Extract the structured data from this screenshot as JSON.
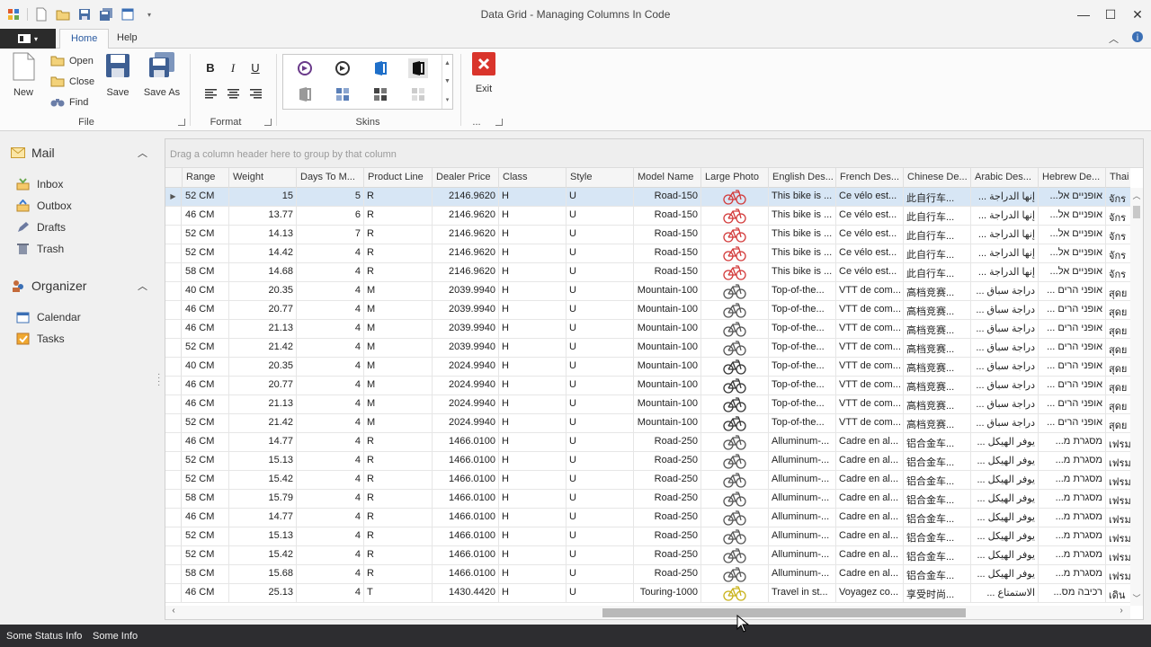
{
  "window": {
    "title": "Data Grid - Managing Columns In Code"
  },
  "ribbon": {
    "tabs": [
      "Home",
      "Help"
    ],
    "file_group": {
      "label": "File",
      "new": "New",
      "open": "Open",
      "close": "Close",
      "find": "Find",
      "save": "Save",
      "save_as": "Save As"
    },
    "format_group": {
      "label": "Format",
      "bold": "B",
      "italic": "I",
      "underline": "U"
    },
    "skins_group": {
      "label": "Skins"
    },
    "exit_group": {
      "label": "...",
      "exit": "Exit"
    }
  },
  "navigation": {
    "mail": {
      "title": "Mail",
      "items": [
        "Inbox",
        "Outbox",
        "Drafts",
        "Trash"
      ]
    },
    "organizer": {
      "title": "Organizer",
      "items": [
        "Calendar",
        "Tasks"
      ]
    }
  },
  "grid": {
    "group_panel_text": "Drag a column header here to group by that column",
    "columns": [
      "Range",
      "Weight",
      "Days To M...",
      "Product Line",
      "Dealer Price",
      "Class",
      "Style",
      "Model Name",
      "Large Photo",
      "English Des...",
      "French Des...",
      "Chinese De...",
      "Arabic Des...",
      "Hebrew De...",
      "Thai De"
    ],
    "rows": [
      [
        "52 CM",
        "15",
        "5",
        "R",
        "2146.9620",
        "H",
        "U",
        "Road-150",
        "",
        "This bike is ...",
        "Ce vélo est...",
        "此自行车...",
        "إنها الدراجة ...",
        "אופניים אל...",
        "จักร"
      ],
      [
        "46 CM",
        "13.77",
        "6",
        "R",
        "2146.9620",
        "H",
        "U",
        "Road-150",
        "",
        "This bike is ...",
        "Ce vélo est...",
        "此自行车...",
        "إنها الدراجة ...",
        "אופניים אל...",
        "จักร"
      ],
      [
        "52 CM",
        "14.13",
        "7",
        "R",
        "2146.9620",
        "H",
        "U",
        "Road-150",
        "",
        "This bike is ...",
        "Ce vélo est...",
        "此自行车...",
        "إنها الدراجة ...",
        "אופניים אל...",
        "จักร"
      ],
      [
        "52 CM",
        "14.42",
        "4",
        "R",
        "2146.9620",
        "H",
        "U",
        "Road-150",
        "",
        "This bike is ...",
        "Ce vélo est...",
        "此自行车...",
        "إنها الدراجة ...",
        "אופניים אל...",
        "จักร"
      ],
      [
        "58 CM",
        "14.68",
        "4",
        "R",
        "2146.9620",
        "H",
        "U",
        "Road-150",
        "",
        "This bike is ...",
        "Ce vélo est...",
        "此自行车...",
        "إنها الدراجة ...",
        "אופניים אל...",
        "จักร"
      ],
      [
        "40 CM",
        "20.35",
        "4",
        "M",
        "2039.9940",
        "H",
        "U",
        "Mountain-100",
        "",
        "Top-of-the...",
        "VTT de com...",
        "高档竞赛...",
        "دراجة سباق ...",
        "אופני הרים ...",
        "สุดย"
      ],
      [
        "46 CM",
        "20.77",
        "4",
        "M",
        "2039.9940",
        "H",
        "U",
        "Mountain-100",
        "",
        "Top-of-the...",
        "VTT de com...",
        "高档竞赛...",
        "دراجة سباق ...",
        "אופני הרים ...",
        "สุดย"
      ],
      [
        "46 CM",
        "21.13",
        "4",
        "M",
        "2039.9940",
        "H",
        "U",
        "Mountain-100",
        "",
        "Top-of-the...",
        "VTT de com...",
        "高档竞赛...",
        "دراجة سباق ...",
        "אופני הרים ...",
        "สุดย"
      ],
      [
        "52 CM",
        "21.42",
        "4",
        "M",
        "2039.9940",
        "H",
        "U",
        "Mountain-100",
        "",
        "Top-of-the...",
        "VTT de com...",
        "高档竞赛...",
        "دراجة سباق ...",
        "אופני הרים ...",
        "สุดย"
      ],
      [
        "40 CM",
        "20.35",
        "4",
        "M",
        "2024.9940",
        "H",
        "U",
        "Mountain-100",
        "",
        "Top-of-the...",
        "VTT de com...",
        "高档竞赛...",
        "دراجة سباق ...",
        "אופני הרים ...",
        "สุดย"
      ],
      [
        "46 CM",
        "20.77",
        "4",
        "M",
        "2024.9940",
        "H",
        "U",
        "Mountain-100",
        "",
        "Top-of-the...",
        "VTT de com...",
        "高档竞赛...",
        "دراجة سباق ...",
        "אופני הרים ...",
        "สุดย"
      ],
      [
        "46 CM",
        "21.13",
        "4",
        "M",
        "2024.9940",
        "H",
        "U",
        "Mountain-100",
        "",
        "Top-of-the...",
        "VTT de com...",
        "高档竞赛...",
        "دراجة سباق ...",
        "אופני הרים ...",
        "สุดย"
      ],
      [
        "52 CM",
        "21.42",
        "4",
        "M",
        "2024.9940",
        "H",
        "U",
        "Mountain-100",
        "",
        "Top-of-the...",
        "VTT de com...",
        "高档竞赛...",
        "دراجة سباق ...",
        "אופני הרים ...",
        "สุดย"
      ],
      [
        "46 CM",
        "14.77",
        "4",
        "R",
        "1466.0100",
        "H",
        "U",
        "Road-250",
        "",
        "Alluminum-...",
        "Cadre en al...",
        "铝合金车...",
        "يوفر الهيكل ...",
        "מסגרת מ...",
        "เฟรม"
      ],
      [
        "52 CM",
        "15.13",
        "4",
        "R",
        "1466.0100",
        "H",
        "U",
        "Road-250",
        "",
        "Alluminum-...",
        "Cadre en al...",
        "铝合金车...",
        "يوفر الهيكل ...",
        "מסגרת מ...",
        "เฟรม"
      ],
      [
        "52 CM",
        "15.42",
        "4",
        "R",
        "1466.0100",
        "H",
        "U",
        "Road-250",
        "",
        "Alluminum-...",
        "Cadre en al...",
        "铝合金车...",
        "يوفر الهيكل ...",
        "מסגרת מ...",
        "เฟรม"
      ],
      [
        "58 CM",
        "15.79",
        "4",
        "R",
        "1466.0100",
        "H",
        "U",
        "Road-250",
        "",
        "Alluminum-...",
        "Cadre en al...",
        "铝合金车...",
        "يوفر الهيكل ...",
        "מסגרת מ...",
        "เฟรม"
      ],
      [
        "46 CM",
        "14.77",
        "4",
        "R",
        "1466.0100",
        "H",
        "U",
        "Road-250",
        "",
        "Alluminum-...",
        "Cadre en al...",
        "铝合金车...",
        "يوفر الهيكل ...",
        "מסגרת מ...",
        "เฟรม"
      ],
      [
        "52 CM",
        "15.13",
        "4",
        "R",
        "1466.0100",
        "H",
        "U",
        "Road-250",
        "",
        "Alluminum-...",
        "Cadre en al...",
        "铝合金车...",
        "يوفر الهيكل ...",
        "מסגרת מ...",
        "เฟรม"
      ],
      [
        "52 CM",
        "15.42",
        "4",
        "R",
        "1466.0100",
        "H",
        "U",
        "Road-250",
        "",
        "Alluminum-...",
        "Cadre en al...",
        "铝合金车...",
        "يوفر الهيكل ...",
        "מסגרת מ...",
        "เฟรม"
      ],
      [
        "58 CM",
        "15.68",
        "4",
        "R",
        "1466.0100",
        "H",
        "U",
        "Road-250",
        "",
        "Alluminum-...",
        "Cadre en al...",
        "铝合金车...",
        "يوفر الهيكل ...",
        "מסגרת מ...",
        "เฟรม"
      ],
      [
        "46 CM",
        "25.13",
        "4",
        "T",
        "1430.4420",
        "H",
        "U",
        "Touring-1000",
        "",
        "Travel in st...",
        "Voyagez co...",
        "享受时尚...",
        "الاستمتاع ...",
        "רכיבה מס...",
        "เดิน"
      ]
    ],
    "photo_colors": [
      "#d33a3a",
      "#d33a3a",
      "#d33a3a",
      "#d33a3a",
      "#d33a3a",
      "#555555",
      "#555555",
      "#555555",
      "#555555",
      "#333333",
      "#333333",
      "#333333",
      "#333333",
      "#555555",
      "#555555",
      "#555555",
      "#555555",
      "#555555",
      "#555555",
      "#555555",
      "#555555",
      "#c9b21a"
    ]
  },
  "status": {
    "left": "Some Status Info",
    "right": "Some Info"
  },
  "colors": {
    "accent": "#2a5aa0",
    "statusbar": "#2d2d30",
    "selected_row": "#d7e6f5",
    "exit_red": "#d9342b"
  }
}
